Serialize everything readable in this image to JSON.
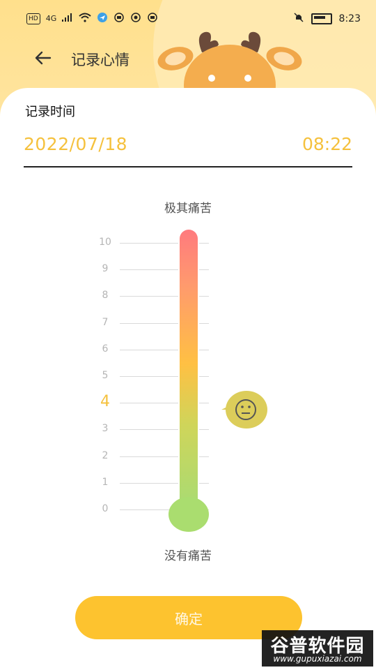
{
  "status_bar": {
    "left_icons": [
      "HD",
      "4G",
      "signal-icon",
      "wifi-icon",
      "location-icon",
      "app-icon-1",
      "app-icon-2",
      "app-icon-3"
    ],
    "hd_label": "HD",
    "network_label": "4G",
    "right_icons": [
      "mute-bell-icon",
      "battery-icon"
    ],
    "time": "8:23"
  },
  "header": {
    "title": "记录心情",
    "back_icon": "arrow-left-icon"
  },
  "record": {
    "label": "记录时间",
    "date": "2022/07/18",
    "time": "08:22"
  },
  "pain_scale": {
    "top_label": "极其痛苦",
    "bottom_label": "没有痛苦",
    "ticks": [
      "10",
      "9",
      "8",
      "7",
      "6",
      "5",
      "4",
      "3",
      "2",
      "1",
      "0"
    ],
    "selected_value": 4,
    "indicator_icon": "neutral-face-icon",
    "gradient_colors": [
      "#ff7a7e",
      "#ffc043",
      "#a8db73"
    ]
  },
  "actions": {
    "confirm_label": "确定"
  },
  "watermark": {
    "main": "谷普软件园",
    "sub": "www.gupuxiazai.com"
  },
  "colors": {
    "accent": "#f5c13d",
    "button": "#fdc32f",
    "header_bg": "#ffe08c"
  }
}
